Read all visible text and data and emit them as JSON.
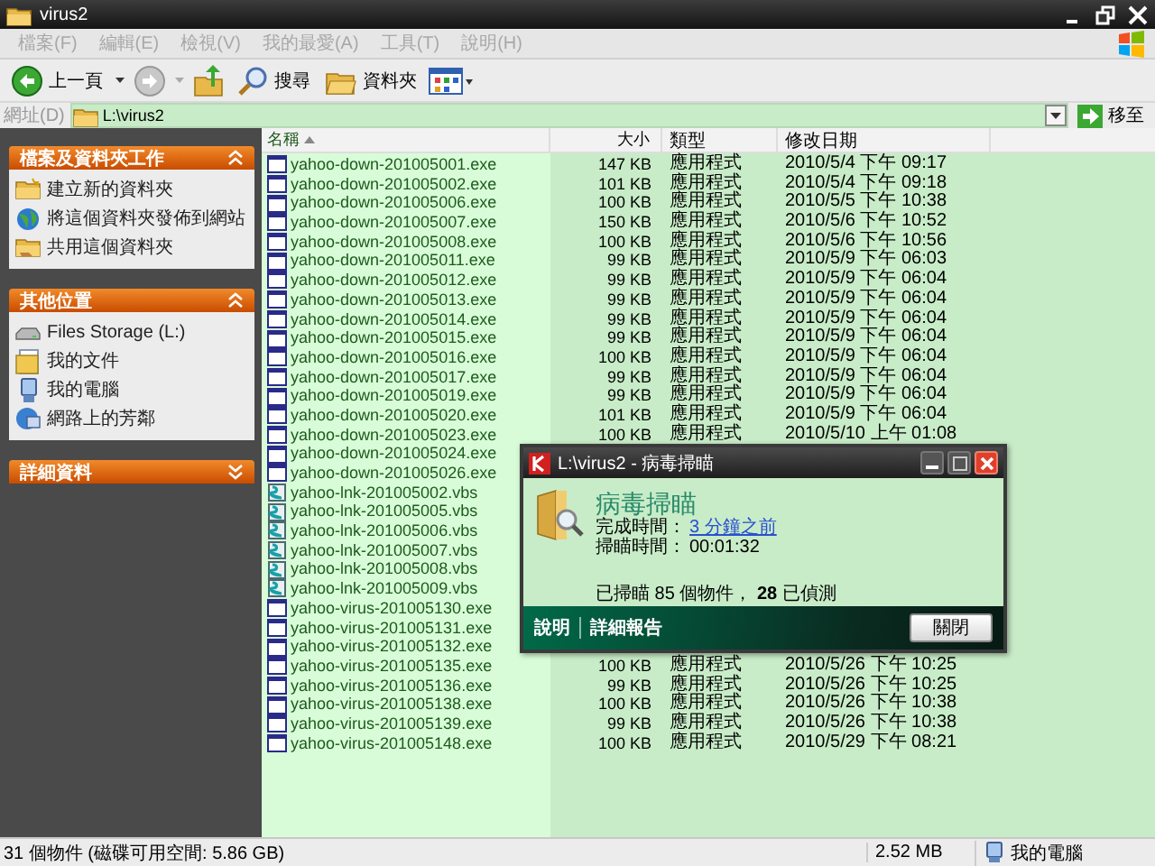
{
  "window": {
    "title": "virus2"
  },
  "menu": [
    {
      "label": "檔案(F)",
      "disabled": true
    },
    {
      "label": "編輯(E)",
      "disabled": true
    },
    {
      "label": "檢視(V)",
      "disabled": true
    },
    {
      "label": "我的最愛(A)",
      "disabled": true
    },
    {
      "label": "工具(T)",
      "disabled": true
    },
    {
      "label": "說明(H)",
      "disabled": true
    }
  ],
  "toolbar": {
    "back": "上一頁",
    "search": "搜尋",
    "folders": "資料夾"
  },
  "address": {
    "label": "網址(D)",
    "value": "L:\\virus2",
    "go": "移至"
  },
  "task_panels": [
    {
      "title": "檔案及資料夾工作",
      "expanded": true,
      "items": [
        {
          "kind": "new-folder",
          "label": "建立新的資料夾"
        },
        {
          "kind": "publish",
          "label": "將這個資料夾發佈到網站"
        },
        {
          "kind": "share",
          "label": "共用這個資料夾"
        }
      ]
    },
    {
      "title": "其他位置",
      "expanded": true,
      "items": [
        {
          "kind": "drive",
          "label": "Files Storage (L:)"
        },
        {
          "kind": "documents",
          "label": "我的文件"
        },
        {
          "kind": "computer",
          "label": "我的電腦"
        },
        {
          "kind": "network",
          "label": "網路上的芳鄰"
        }
      ]
    },
    {
      "title": "詳細資料",
      "expanded": false
    }
  ],
  "file_list": {
    "columns": [
      {
        "label": "名稱",
        "sorted": true
      },
      {
        "label": "大小",
        "sorted": false
      },
      {
        "label": "類型",
        "sorted": false
      },
      {
        "label": "修改日期",
        "sorted": false
      }
    ],
    "rows": [
      {
        "kind": "exe",
        "name": "yahoo-down-201005001.exe",
        "size": "147 KB",
        "type": "應用程式",
        "modified": "2010/5/4 下午 09:17"
      },
      {
        "kind": "exe",
        "name": "yahoo-down-201005002.exe",
        "size": "101 KB",
        "type": "應用程式",
        "modified": "2010/5/4 下午 09:18"
      },
      {
        "kind": "exe",
        "name": "yahoo-down-201005006.exe",
        "size": "100 KB",
        "type": "應用程式",
        "modified": "2010/5/5 下午 10:38"
      },
      {
        "kind": "exe",
        "name": "yahoo-down-201005007.exe",
        "size": "150 KB",
        "type": "應用程式",
        "modified": "2010/5/6 下午 10:52"
      },
      {
        "kind": "exe",
        "name": "yahoo-down-201005008.exe",
        "size": "100 KB",
        "type": "應用程式",
        "modified": "2010/5/6 下午 10:56"
      },
      {
        "kind": "exe",
        "name": "yahoo-down-201005011.exe",
        "size": "99 KB",
        "type": "應用程式",
        "modified": "2010/5/9 下午 06:03"
      },
      {
        "kind": "exe",
        "name": "yahoo-down-201005012.exe",
        "size": "99 KB",
        "type": "應用程式",
        "modified": "2010/5/9 下午 06:04"
      },
      {
        "kind": "exe",
        "name": "yahoo-down-201005013.exe",
        "size": "99 KB",
        "type": "應用程式",
        "modified": "2010/5/9 下午 06:04"
      },
      {
        "kind": "exe",
        "name": "yahoo-down-201005014.exe",
        "size": "99 KB",
        "type": "應用程式",
        "modified": "2010/5/9 下午 06:04"
      },
      {
        "kind": "exe",
        "name": "yahoo-down-201005015.exe",
        "size": "99 KB",
        "type": "應用程式",
        "modified": "2010/5/9 下午 06:04"
      },
      {
        "kind": "exe",
        "name": "yahoo-down-201005016.exe",
        "size": "100 KB",
        "type": "應用程式",
        "modified": "2010/5/9 下午 06:04"
      },
      {
        "kind": "exe",
        "name": "yahoo-down-201005017.exe",
        "size": "99 KB",
        "type": "應用程式",
        "modified": "2010/5/9 下午 06:04"
      },
      {
        "kind": "exe",
        "name": "yahoo-down-201005019.exe",
        "size": "99 KB",
        "type": "應用程式",
        "modified": "2010/5/9 下午 06:04"
      },
      {
        "kind": "exe",
        "name": "yahoo-down-201005020.exe",
        "size": "101 KB",
        "type": "應用程式",
        "modified": "2010/5/9 下午 06:04"
      },
      {
        "kind": "exe",
        "name": "yahoo-down-201005023.exe",
        "size": "100 KB",
        "type": "應用程式",
        "modified": "2010/5/10 上午 01:08"
      },
      {
        "kind": "exe",
        "name": "yahoo-down-201005024.exe"
      },
      {
        "kind": "exe",
        "name": "yahoo-down-201005026.exe"
      },
      {
        "kind": "vbs",
        "name": "yahoo-lnk-201005002.vbs"
      },
      {
        "kind": "vbs",
        "name": "yahoo-lnk-201005005.vbs"
      },
      {
        "kind": "vbs",
        "name": "yahoo-lnk-201005006.vbs"
      },
      {
        "kind": "vbs",
        "name": "yahoo-lnk-201005007.vbs"
      },
      {
        "kind": "vbs",
        "name": "yahoo-lnk-201005008.vbs"
      },
      {
        "kind": "vbs",
        "name": "yahoo-lnk-201005009.vbs"
      },
      {
        "kind": "exe",
        "name": "yahoo-virus-201005130.exe"
      },
      {
        "kind": "exe",
        "name": "yahoo-virus-201005131.exe"
      },
      {
        "kind": "exe",
        "name": "yahoo-virus-201005132.exe"
      },
      {
        "kind": "exe",
        "name": "yahoo-virus-201005135.exe",
        "size": "100 KB",
        "type": "應用程式",
        "modified": "2010/5/26 下午 10:25"
      },
      {
        "kind": "exe",
        "name": "yahoo-virus-201005136.exe",
        "size": "99 KB",
        "type": "應用程式",
        "modified": "2010/5/26 下午 10:25"
      },
      {
        "kind": "exe",
        "name": "yahoo-virus-201005138.exe",
        "size": "100 KB",
        "type": "應用程式",
        "modified": "2010/5/26 下午 10:38"
      },
      {
        "kind": "exe",
        "name": "yahoo-virus-201005139.exe",
        "size": "99 KB",
        "type": "應用程式",
        "modified": "2010/5/26 下午 10:38"
      },
      {
        "kind": "exe",
        "name": "yahoo-virus-201005148.exe",
        "size": "100 KB",
        "type": "應用程式",
        "modified": "2010/5/29 下午 08:21"
      }
    ]
  },
  "status_bar": {
    "objects": "31 個物件 (磁碟可用空間: 5.86 GB)",
    "size": "2.52 MB",
    "location": "我的電腦"
  },
  "dialog": {
    "title": "L:\\virus2 - 病毒掃瞄",
    "heading": "病毒掃瞄",
    "completed_label": "完成時間：",
    "completed_value": "3 分鐘之前",
    "duration_label": "掃瞄時間：",
    "duration_value": "00:01:32",
    "summary": "已掃瞄 85 個物件， **28** 已偵測",
    "links": [
      "說明",
      "詳細報告"
    ],
    "close": "關閉"
  }
}
